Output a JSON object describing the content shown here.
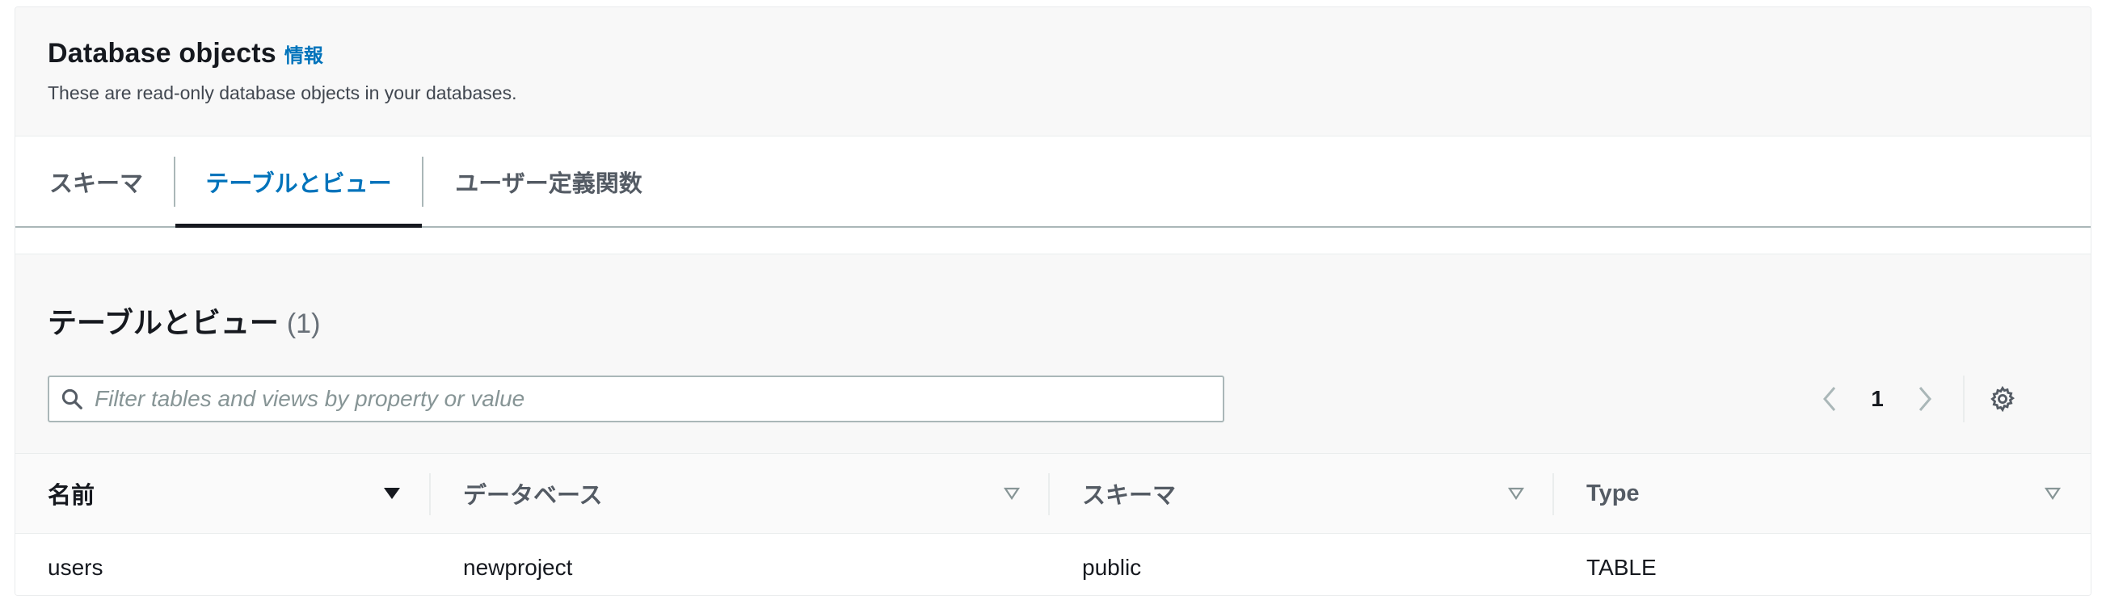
{
  "panel": {
    "title": "Database objects",
    "info_link": "情報",
    "description": "These are read-only database objects in your databases."
  },
  "tabs": [
    {
      "label": "スキーマ",
      "active": false
    },
    {
      "label": "テーブルとビュー",
      "active": true
    },
    {
      "label": "ユーザー定義関数",
      "active": false
    }
  ],
  "table_section": {
    "title": "テーブルとビュー",
    "count": "(1)",
    "filter_placeholder": "Filter tables and views by property or value",
    "filter_value": "",
    "pagination": {
      "current_page": "1"
    },
    "columns": [
      {
        "label": "名前",
        "sorted": true
      },
      {
        "label": "データベース",
        "sorted": false
      },
      {
        "label": "スキーマ",
        "sorted": false
      },
      {
        "label": "Type",
        "sorted": false
      }
    ],
    "rows": [
      {
        "name": "users",
        "database": "newproject",
        "schema": "public",
        "type": "TABLE"
      }
    ]
  },
  "colors": {
    "accent": "#0073bb",
    "text_primary": "#16191f",
    "text_secondary": "#545b64",
    "border": "#aab7b8",
    "header_bg": "#f8f8f8"
  },
  "icons": {
    "search": "search-icon",
    "prev": "chevron-left-icon",
    "next": "chevron-right-icon",
    "settings": "gear-icon",
    "sort_active": "caret-down-filled-icon",
    "sort_inactive": "caret-down-outline-icon"
  }
}
